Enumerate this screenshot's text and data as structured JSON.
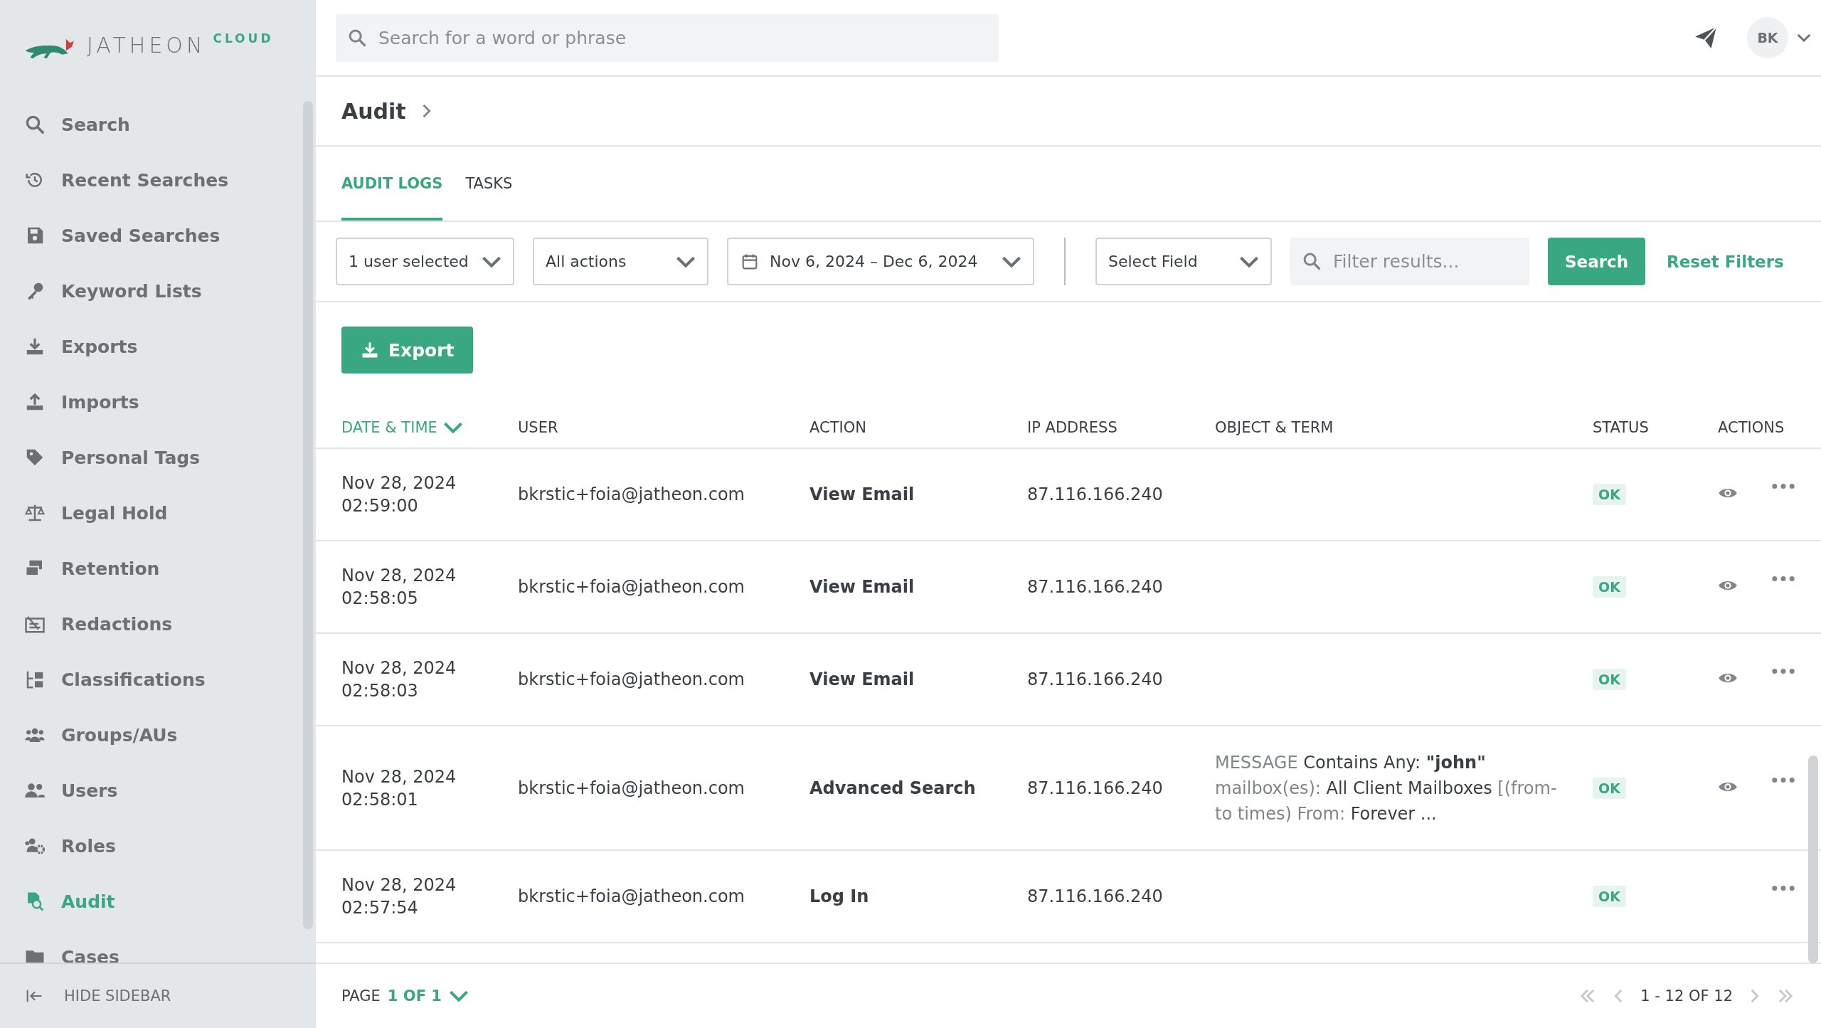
{
  "logo": {
    "wordmark": "JATHEON",
    "suffix": "CLOUD"
  },
  "sidebar": {
    "items": [
      {
        "label": "Search",
        "selected": false
      },
      {
        "label": "Recent Searches",
        "selected": false
      },
      {
        "label": "Saved Searches",
        "selected": false
      },
      {
        "label": "Keyword Lists",
        "selected": false
      },
      {
        "label": "Exports",
        "selected": false
      },
      {
        "label": "Imports",
        "selected": false
      },
      {
        "label": "Personal Tags",
        "selected": false
      },
      {
        "label": "Legal Hold",
        "selected": false
      },
      {
        "label": "Retention",
        "selected": false
      },
      {
        "label": "Redactions",
        "selected": false
      },
      {
        "label": "Classifications",
        "selected": false
      },
      {
        "label": "Groups/AUs",
        "selected": false
      },
      {
        "label": "Users",
        "selected": false
      },
      {
        "label": "Roles",
        "selected": false
      },
      {
        "label": "Audit",
        "selected": true
      },
      {
        "label": "Cases",
        "selected": false
      }
    ],
    "hide_label": "HIDE SIDEBAR"
  },
  "top_bar": {
    "search": {
      "placeholder": "Search for a word or phrase"
    },
    "avatar": "BK"
  },
  "breadcrumb": {
    "title": "Audit"
  },
  "tabs": [
    {
      "label": "AUDIT LOGS",
      "selected": true
    },
    {
      "label": "TASKS",
      "selected": false
    }
  ],
  "filters": {
    "user": "1 user selected",
    "actions": "All actions",
    "date_range": "Nov 6, 2024 – Dec 6, 2024",
    "field": "Select Field",
    "filter": {
      "placeholder": "Filter results..."
    },
    "search_button": "Search",
    "reset": "Reset Filters"
  },
  "export_button": "Export",
  "table": {
    "columns": [
      {
        "label": "DATE & TIME",
        "sorted": true
      },
      {
        "label": "USER",
        "sorted": false
      },
      {
        "label": "ACTION",
        "sorted": false
      },
      {
        "label": "IP ADDRESS",
        "sorted": false
      },
      {
        "label": "OBJECT & TERM",
        "sorted": false
      },
      {
        "label": "STATUS",
        "sorted": false
      },
      {
        "label": "ACTIONS",
        "sorted": false
      }
    ],
    "rows": [
      {
        "date": "Nov 28, 2024",
        "time": "02:59:00",
        "user": "bkrstic+foia@jatheon.com",
        "action": "View Email",
        "ip": "87.116.166.240",
        "object": [],
        "status": "OK",
        "view": true
      },
      {
        "date": "Nov 28, 2024",
        "time": "02:58:05",
        "user": "bkrstic+foia@jatheon.com",
        "action": "View Email",
        "ip": "87.116.166.240",
        "object": [],
        "status": "OK",
        "view": true
      },
      {
        "date": "Nov 28, 2024",
        "time": "02:58:03",
        "user": "bkrstic+foia@jatheon.com",
        "action": "View Email",
        "ip": "87.116.166.240",
        "object": [],
        "status": "OK",
        "view": true
      },
      {
        "date": "Nov 28, 2024",
        "time": "02:58:01",
        "user": "bkrstic+foia@jatheon.com",
        "action": "Advanced Search",
        "ip": "87.116.166.240",
        "object": [
          {
            "text": "MESSAGE",
            "kind": "muted"
          },
          {
            "text": "Contains Any:",
            "kind": "plain"
          },
          {
            "text": "\"john\"",
            "kind": "bold"
          },
          {
            "text": "mailbox(es):",
            "kind": "muted"
          },
          {
            "text": "All Client Mailboxes",
            "kind": "plain"
          },
          {
            "text": "[(from-to times) From:",
            "kind": "muted"
          },
          {
            "text": "Forever ...",
            "kind": "plain"
          }
        ],
        "status": "OK",
        "view": true
      },
      {
        "date": "Nov 28, 2024",
        "time": "02:57:54",
        "user": "bkrstic+foia@jatheon.com",
        "action": "Log In",
        "ip": "87.116.166.240",
        "object": [],
        "status": "OK",
        "view": false
      }
    ]
  },
  "footer": {
    "page_label": "PAGE",
    "page_value": "1 OF 1",
    "range": "1 - 12 OF 12"
  }
}
